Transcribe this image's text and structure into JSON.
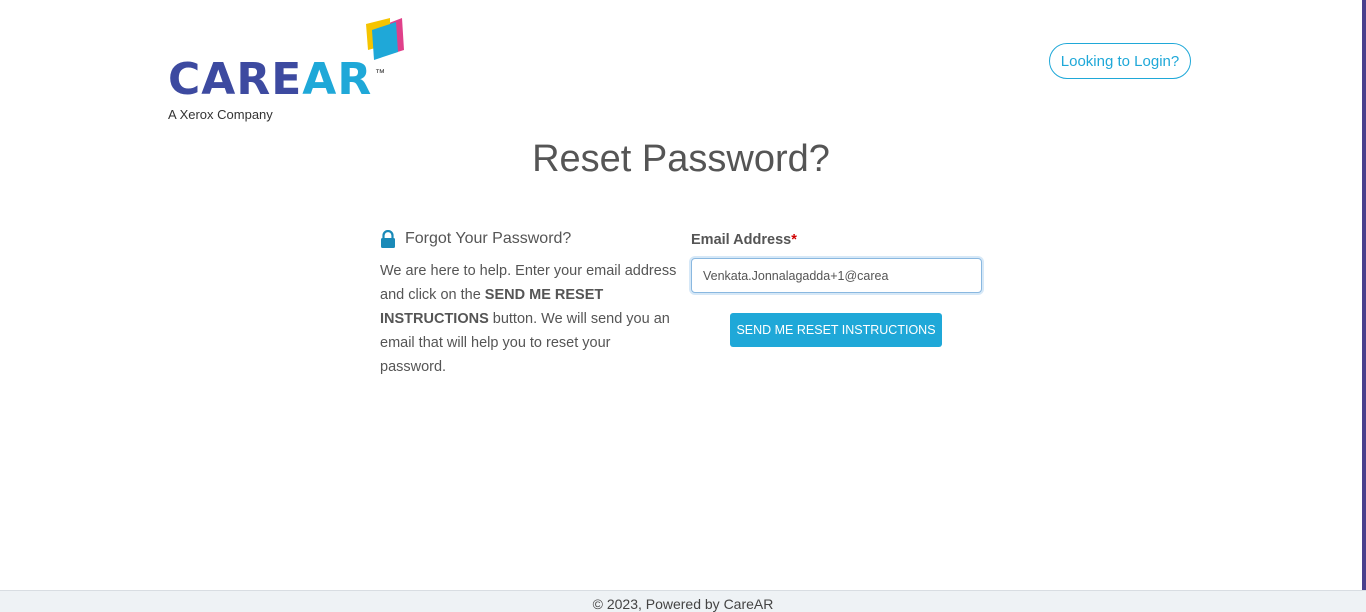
{
  "logo": {
    "word_care": "CARE",
    "word_ar": "AR",
    "trademark": "™",
    "subtitle": "A Xerox Company",
    "mark_colors": [
      "#f5c400",
      "#1fa8d8",
      "#e0408a"
    ]
  },
  "header": {
    "login_link": "Looking to Login?"
  },
  "main": {
    "title": "Reset Password?",
    "help": {
      "icon": "lock-icon",
      "title": "Forgot Your Password?",
      "text_before": "We are here to help. Enter your email address and click on the ",
      "text_bold": "SEND ME RESET INSTRUCTIONS",
      "text_after": " button. We will send you an email that will help you to reset your password."
    },
    "form": {
      "email_label": "Email Address",
      "required_mark": "*",
      "email_value": "Venkata.Jonnalagadda+1@carea",
      "submit_label": "SEND ME RESET INSTRUCTIONS"
    }
  },
  "footer": {
    "text": "© 2023, Powered by CareAR"
  },
  "colors": {
    "accent": "#1fa8d8",
    "brand": "#3d4aa0"
  }
}
